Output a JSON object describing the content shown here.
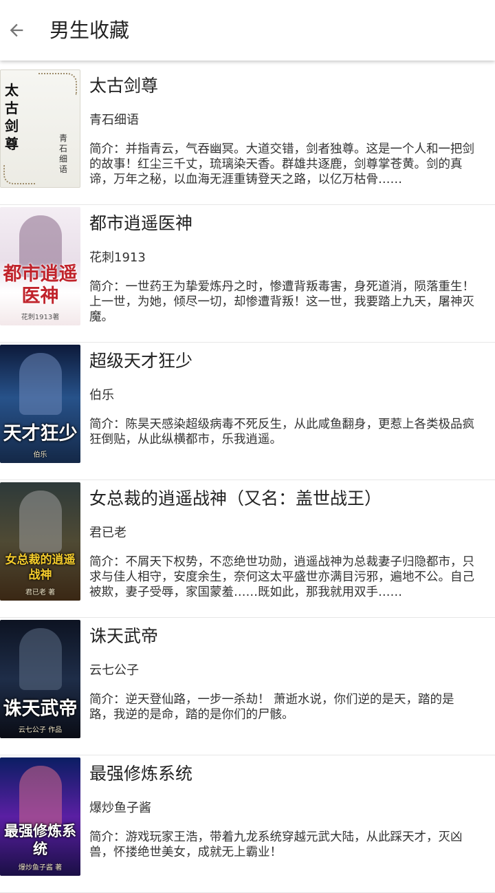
{
  "header": {
    "title": "男生收藏",
    "back_icon": "arrow-left-icon"
  },
  "books": [
    {
      "title": "太古剑尊",
      "author": "青石细语",
      "intro": "简介：并指青云，气吞幽冥。大道交错，剑者独尊。这是一个人和一把剑的故事！红尘三千丈，琉璃染天香。群雄共逐鹿，剑尊掌苍黄。剑的真谛，万年之秘，以血海无涯重铸登天之路，以亿万枯骨……",
      "cover": {
        "title": "太古剑尊",
        "author": "青石细语"
      }
    },
    {
      "title": "都市逍遥医神",
      "author": "花刺1913",
      "intro": "简介：一世药王为挚爱炼丹之时，惨遭背叛毒害，身死道消，陨落重生！上一世，为她，倾尽一切，却惨遭背叛！这一世，我要踏上九天，屠神灭魔。",
      "cover": {
        "title": "都市逍遥医神",
        "author": "花刺1913著"
      }
    },
    {
      "title": "超级天才狂少",
      "author": "伯乐",
      "intro": "简介：陈昊天感染超级病毒不死反生，从此咸鱼翻身，更惹上各类极品疯狂倒贴，从此纵横都市，乐我逍遥。",
      "cover": {
        "title": "天才狂少",
        "author": "伯乐"
      }
    },
    {
      "title": "女总裁的逍遥战神（又名：盖世战王）",
      "author": "君已老",
      "intro": "简介：不屑天下权势，不恋绝世功勋，逍遥战神为总裁妻子归隐都市，只求与佳人相守，安度余生，奈何这太平盛世亦满目污邪，遍地不公。自己被欺，妻子受辱，家国蒙羞……既如此，那我就用双手……",
      "cover": {
        "title": "女总裁的逍遥战神",
        "author": "君已老 著"
      }
    },
    {
      "title": "诛天武帝",
      "author": "云七公子",
      "intro": "简介：逆天登仙路，一步一杀劫！ 萧逝水说，你们逆的是天，踏的是路，我逆的是命，踏的是你们的尸骸。",
      "cover": {
        "title": "诛天武帝",
        "author": "云七公子 作品"
      }
    },
    {
      "title": "最强修炼系统",
      "author": "爆炒鱼子酱",
      "intro": "简介：游戏玩家王浩，带着九龙系统穿越元武大陆，从此踩天才，灭凶兽，怀搂绝世美女，成就无上霸业！",
      "cover": {
        "title": "最强修炼系统",
        "author": "爆炒鱼子酱 著"
      }
    }
  ]
}
